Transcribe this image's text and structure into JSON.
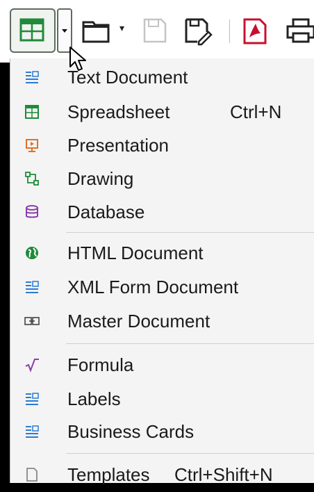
{
  "toolbar": {
    "buttons": [
      {
        "name": "new-spreadsheet",
        "icon": "spreadsheet-icon"
      },
      {
        "name": "new-dropdown",
        "icon": "chevron-down-icon"
      },
      {
        "name": "open",
        "icon": "folder-icon"
      },
      {
        "name": "open-dropdown",
        "icon": "chevron-down-icon"
      },
      {
        "name": "save",
        "icon": "save-icon",
        "disabled": true
      },
      {
        "name": "save-as",
        "icon": "save-as-icon"
      },
      {
        "name": "export-pdf",
        "icon": "pdf-icon"
      },
      {
        "name": "print",
        "icon": "printer-icon"
      }
    ]
  },
  "menu": {
    "items": [
      {
        "label": "Text Document",
        "shortcut": "",
        "icon": "writer-document-icon",
        "color": "#2a7bd3"
      },
      {
        "label": "Spreadsheet",
        "shortcut": "Ctrl+N",
        "icon": "calc-spreadsheet-icon",
        "color": "#1f8a3a"
      },
      {
        "label": "Presentation",
        "shortcut": "",
        "icon": "impress-presentation-icon",
        "color": "#e0702a"
      },
      {
        "label": "Drawing",
        "shortcut": "",
        "icon": "draw-drawing-icon",
        "color": "#1f8a3a"
      },
      {
        "label": "Database",
        "shortcut": "",
        "icon": "base-database-icon",
        "color": "#8a3fa8"
      },
      {
        "label": "HTML Document",
        "shortcut": "",
        "icon": "globe-html-icon",
        "color": "#1f8a3a"
      },
      {
        "label": "XML Form Document",
        "shortcut": "",
        "icon": "xml-form-icon",
        "color": "#2a7bd3"
      },
      {
        "label": "Master Document",
        "shortcut": "",
        "icon": "master-document-icon",
        "color": "#444444"
      },
      {
        "label": "Formula",
        "shortcut": "",
        "icon": "math-formula-icon",
        "color": "#8a3fa8"
      },
      {
        "label": "Labels",
        "shortcut": "",
        "icon": "labels-icon",
        "color": "#2a7bd3"
      },
      {
        "label": "Business Cards",
        "shortcut": "",
        "icon": "business-cards-icon",
        "color": "#2a7bd3"
      },
      {
        "label": "Templates",
        "shortcut": "Ctrl+Shift+N",
        "icon": "templates-icon",
        "color": "#888888"
      }
    ]
  }
}
